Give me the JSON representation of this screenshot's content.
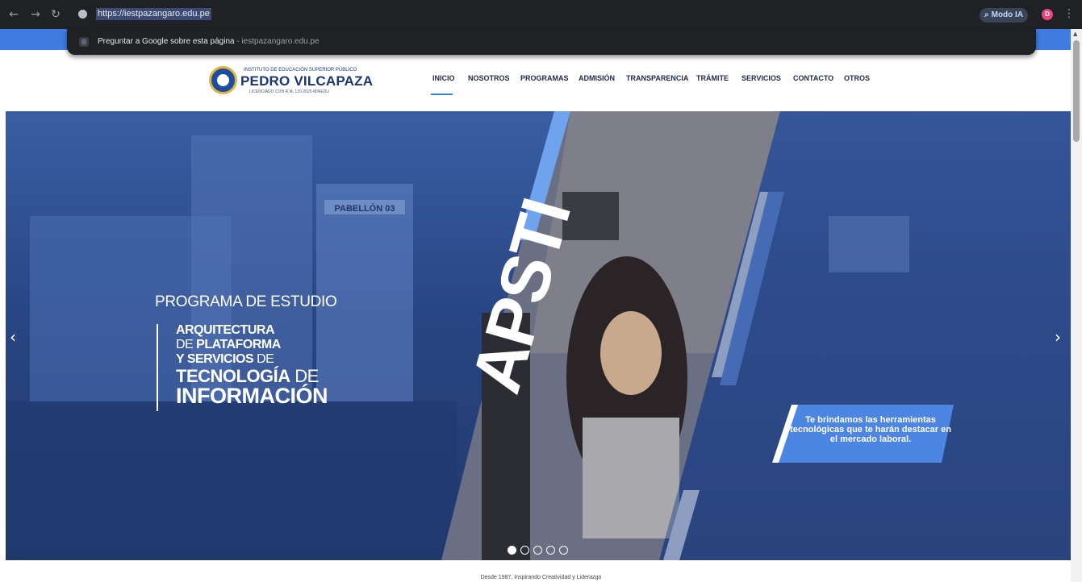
{
  "browser": {
    "back_icon": "←",
    "forward_icon": "→",
    "reload_icon": "↻",
    "url": "https://iestpazangaro.edu.pe",
    "ai_mode_label": "Modo IA",
    "profile_initial": "D",
    "menu_icon": "⋮",
    "suggestion": {
      "prefix": "Preguntar a Google sobre esta página",
      "separator": " - ",
      "domain": "iestpazangaro.edu.pe"
    }
  },
  "header": {
    "logo_top": "INSTITUTO DE EDUCACIÓN SUPERIOR PÚBLICO",
    "logo_name": "PEDRO VILCAPAZA",
    "logo_sub": "LICENCIADO CON R.M. 120-2025-MINEDU",
    "nav": [
      "INICIO",
      "NOSOTROS",
      "PROGRAMAS",
      "ADMISIÓN",
      "TRANSPARENCIA",
      "TRÁMITE",
      "SERVICIOS",
      "CONTACTO",
      "OTROS"
    ],
    "active_index": 0
  },
  "hero": {
    "program_label": "PROGRAMA DE ESTUDIO",
    "line1": "ARQUITECTURA",
    "line2_thin": "DE ",
    "line2_bold": "PLATAFORMA",
    "line3_bold": "Y SERVICIOS",
    "line3_thin": " DE",
    "line4_bold": "TECNOLOGÍA",
    "line4_thin": " DE",
    "line5_bold": "INFORMACIÓN",
    "acronym": "APSTI",
    "pavilion_sign": "PABELLÓN 03",
    "promo": "Te brindamos las herramientas tecnológicas que te harán destacar en el mercado laboral.",
    "prev_icon": "‹",
    "next_icon": "›",
    "slides_total": 5,
    "active_slide": 1
  },
  "tagline": "Desde 1987, Inspirando Creatividad y Liderazgo",
  "colors": {
    "chrome": "#202124",
    "brand_blue": "#3f7be0",
    "navy": "#1b3672",
    "accent": "#3d7dd8"
  }
}
